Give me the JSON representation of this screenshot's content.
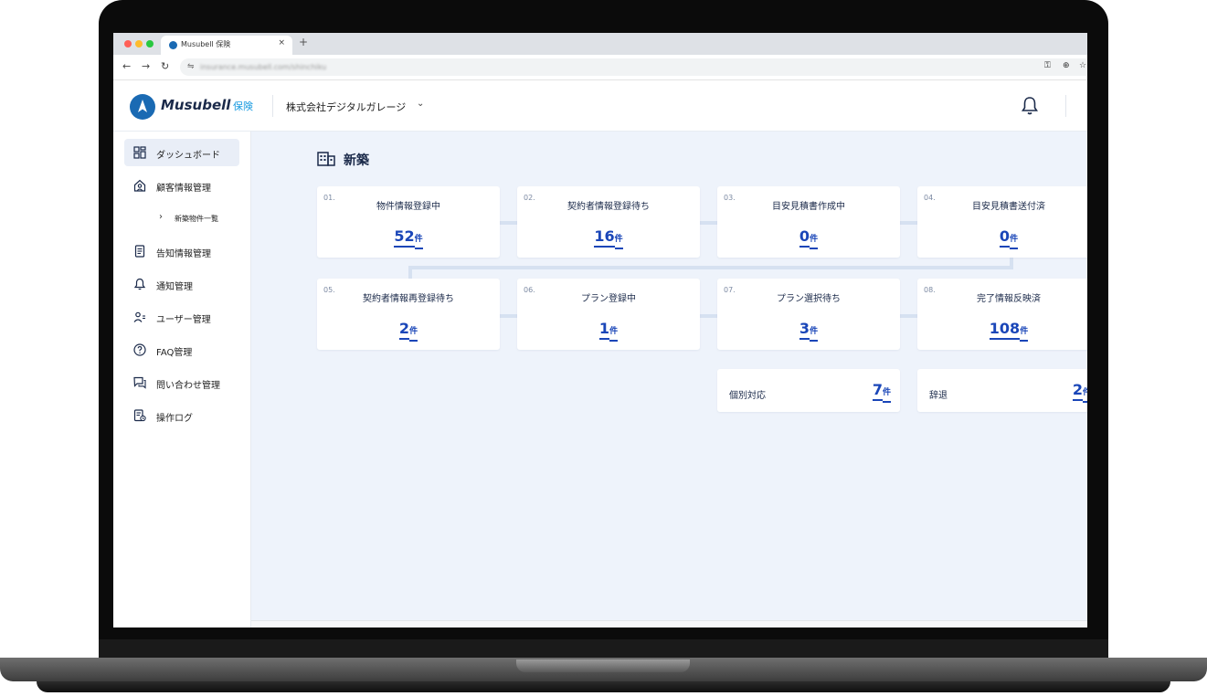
{
  "browser": {
    "tab_title": "Musubell 保険",
    "tab_close": "×",
    "new_tab": "+",
    "url": "insurance.musubell.com/shinchiku"
  },
  "header": {
    "logo_text": "Musubell",
    "logo_sub": "保険",
    "company": "株式会社デジタルガレージ",
    "company_chevron": "chevron-down-icon",
    "bell_icon": "bell-icon"
  },
  "sidebar": {
    "items": [
      {
        "label": "ダッシュボード",
        "icon": "dashboard-icon",
        "active": true
      },
      {
        "label": "顧客情報管理",
        "icon": "house-user-icon",
        "active": false
      },
      {
        "label": "新築物件一覧",
        "icon": "chevron-right-icon",
        "sub": true
      },
      {
        "label": "告知情報管理",
        "icon": "document-icon",
        "active": false
      },
      {
        "label": "通知管理",
        "icon": "bell-icon",
        "active": false
      },
      {
        "label": "ユーザー管理",
        "icon": "users-icon",
        "active": false
      },
      {
        "label": "FAQ管理",
        "icon": "question-icon",
        "active": false
      },
      {
        "label": "問い合わせ管理",
        "icon": "chat-icon",
        "active": false
      },
      {
        "label": "操作ログ",
        "icon": "log-icon",
        "active": false
      }
    ]
  },
  "main": {
    "section_title": "新築",
    "section_icon": "building-icon",
    "unit": "件",
    "cards": [
      {
        "num": "01.",
        "label": "物件情報登録中",
        "count": "52"
      },
      {
        "num": "02.",
        "label": "契約者情報登録待ち",
        "count": "16"
      },
      {
        "num": "03.",
        "label": "目安見積書作成中",
        "count": "0"
      },
      {
        "num": "04.",
        "label": "目安見積書送付済",
        "count": "0"
      },
      {
        "num": "05.",
        "label": "契約者情報再登録待ち",
        "count": "2"
      },
      {
        "num": "06.",
        "label": "プラン登録中",
        "count": "1"
      },
      {
        "num": "07.",
        "label": "プラン選択待ち",
        "count": "3"
      },
      {
        "num": "08.",
        "label": "完了情報反映済",
        "count": "108"
      }
    ],
    "extras": [
      {
        "label": "個別対応",
        "count": "7"
      },
      {
        "label": "辞退",
        "count": "2"
      }
    ]
  },
  "colors": {
    "accent": "#1a46b8",
    "brand": "#1a6ab3",
    "background": "#eef3fb"
  }
}
